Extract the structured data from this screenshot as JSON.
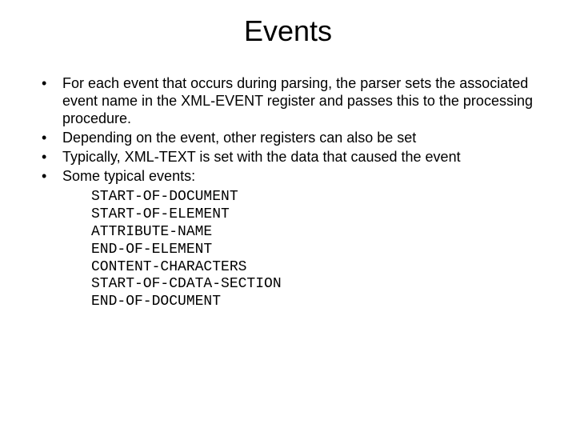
{
  "title": "Events",
  "bullets": [
    "For each event that occurs during parsing, the parser sets the associated event name in the XML-EVENT register and passes this to the processing procedure.",
    "Depending on the event, other registers can also be set",
    "Typically, XML-TEXT is set with the data that caused the event",
    "Some typical events:"
  ],
  "events": [
    "START-OF-DOCUMENT",
    "START-OF-ELEMENT",
    "ATTRIBUTE-NAME",
    "END-OF-ELEMENT",
    "CONTENT-CHARACTERS",
    "START-OF-CDATA-SECTION",
    "END-OF-DOCUMENT"
  ]
}
